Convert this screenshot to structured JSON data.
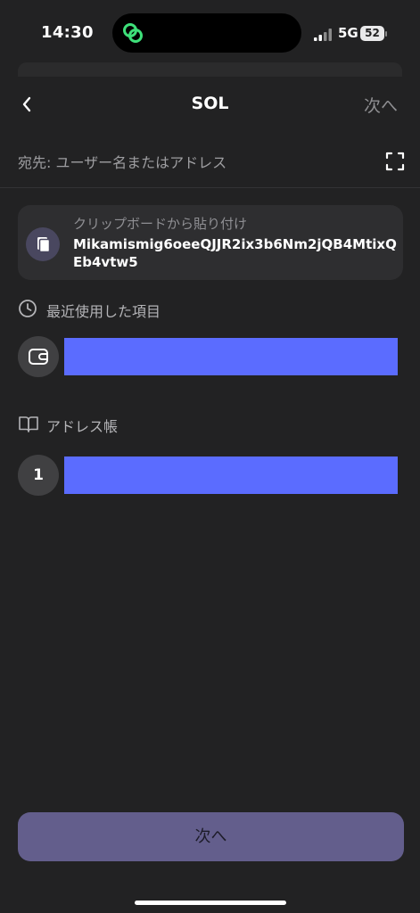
{
  "status_bar": {
    "time": "14:30",
    "network": "5G",
    "battery": "52"
  },
  "nav": {
    "title": "SOL",
    "next_label": "次へ"
  },
  "recipient": {
    "placeholder": "宛先: ユーザー名またはアドレス"
  },
  "clipboard": {
    "title": "クリップボードから貼り付け",
    "address": "Mikamismig6oeeQJJR2ix3b6Nm2jQB4MtixQEb4vtw5"
  },
  "recent": {
    "label": "最近使用した項目"
  },
  "address_book": {
    "label": "アドレス帳",
    "items": [
      {
        "avatar_text": "1"
      }
    ]
  },
  "footer": {
    "next_label": "次へ"
  },
  "colors": {
    "background": "#222223",
    "card": "#2e2e30",
    "redacted_overlay": "#5b6cff",
    "primary_button": "#635e8c",
    "island_icon": "#3ee07a"
  },
  "icons": [
    "link-icon",
    "signal-icon",
    "chevron-left-icon",
    "scan-icon",
    "clipboard-icon",
    "clock-icon",
    "wallet-icon",
    "book-icon"
  ]
}
